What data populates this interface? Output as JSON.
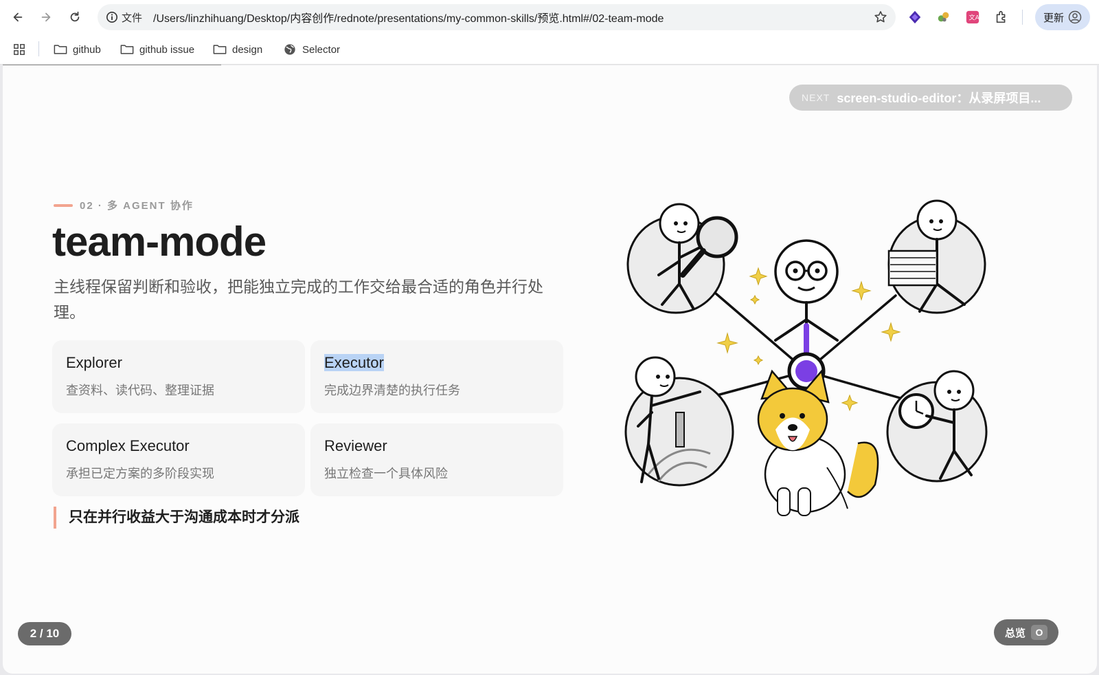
{
  "browser": {
    "file_label": "文件",
    "url": "/Users/linzhihuang/Desktop/内容创作/rednote/presentations/my-common-skills/预览.html#/02-team-mode",
    "update_label": "更新",
    "bookmarks": [
      {
        "label": "github",
        "icon": "folder-icon"
      },
      {
        "label": "github issue",
        "icon": "folder-icon"
      },
      {
        "label": "design",
        "icon": "folder-icon"
      },
      {
        "label": "Selector",
        "icon": "globe-icon"
      }
    ]
  },
  "slide": {
    "next": {
      "tag": "NEXT",
      "title": "screen-studio-editor：从录屏项目..."
    },
    "eyebrow": "02 · 多 AGENT 协作",
    "title": "team-mode",
    "subtitle": "主线程保留判断和验收，把能独立完成的工作交给最合适的角色并行处理。",
    "roles": [
      {
        "name": "Explorer",
        "desc": "查资料、读代码、整理证据"
      },
      {
        "name": "Executor",
        "desc": "完成边界清楚的执行任务"
      },
      {
        "name": "Complex Executor",
        "desc": "承担已定方案的多阶段实现"
      },
      {
        "name": "Reviewer",
        "desc": "独立检查一个具体风险"
      }
    ],
    "note": "只在并行收益大于沟通成本时才分派",
    "page_indicator": "2 / 10",
    "overview": {
      "label": "总览",
      "key": "O"
    }
  },
  "colors": {
    "accent": "#f2a48f",
    "hub": "#7b3fe4",
    "dog": "#f3c93a",
    "sparkle": "#f0cf47"
  }
}
